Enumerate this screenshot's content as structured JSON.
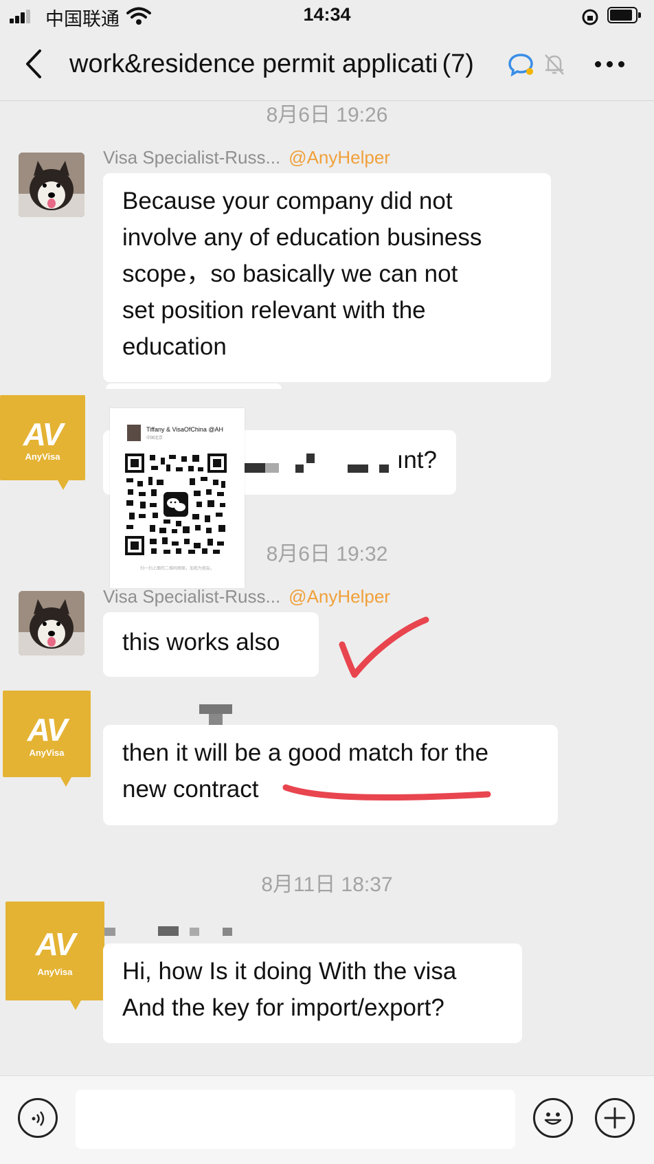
{
  "status_bar": {
    "carrier": "中国联通",
    "time": "14:34"
  },
  "header": {
    "title": "work&residence permit applicati",
    "member_count": "(7)",
    "back_icon": "chevron-left-icon",
    "more_icon": "more-dots-icon"
  },
  "messages": [
    {
      "type": "timestamp",
      "text": "8月6日 19:26"
    },
    {
      "sender": "Visa Specialist-Russ...",
      "mention": "@AnyHelper",
      "avatar": "dog-photo",
      "lines": [
        "Because your company did not",
        "involve any of education business",
        "scope，so basically we can not",
        "set position relevant with the",
        "education"
      ]
    },
    {
      "avatar": "AnyVisa",
      "text_fragment": "ınt?",
      "redacted": true
    },
    {
      "type": "shared_card",
      "card_title": "Tiffany & VisaOfChina @AH",
      "card_subtitle": "中国北京",
      "card_caption": "扫一扫上面的二维码图案，加我为朋友。"
    },
    {
      "type": "timestamp",
      "text": "8月6日 19:32"
    },
    {
      "sender": "Visa Specialist-Russ...",
      "mention": "@AnyHelper",
      "avatar": "dog-photo",
      "lines": [
        "this works also"
      ],
      "annotation": "red-checkmark"
    },
    {
      "avatar": "AnyVisa",
      "lines": [
        "then it will be a good match for the",
        "new contract"
      ],
      "annotation": "red-underline"
    },
    {
      "type": "timestamp",
      "text": "8月11日 18:37"
    },
    {
      "avatar": "AnyVisa",
      "lines": [
        "Hi, how Is it doing With the visa",
        "And the key for import/export?"
      ]
    }
  ],
  "anyvisa_logo": {
    "mark": "AV",
    "word": "AnyVisa",
    "color": "#e4b334"
  },
  "input_bar": {
    "placeholder": "",
    "voice_icon": "voice-icon",
    "emoji_icon": "emoji-icon",
    "plus_icon": "plus-icon"
  },
  "colors": {
    "background": "#ededed",
    "mention": "#f0a03a",
    "annotation_red": "#e8454f"
  }
}
